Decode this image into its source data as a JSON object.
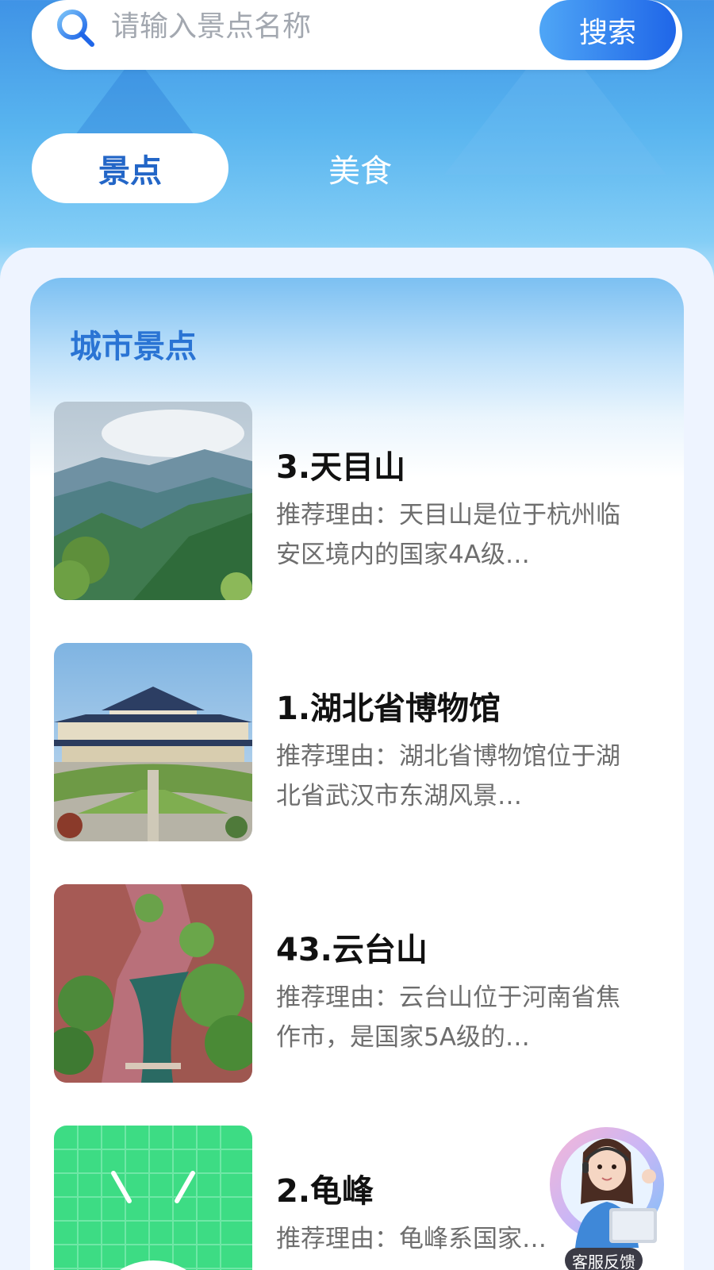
{
  "search": {
    "placeholder": "请输入景点名称",
    "button_label": "搜索"
  },
  "tabs": [
    {
      "label": "景点",
      "active": true
    },
    {
      "label": "美食",
      "active": false
    }
  ],
  "section": {
    "title": "城市景点"
  },
  "items": [
    {
      "title": "3.天目山",
      "desc": "推荐理由：天目山是位于杭州临安区境内的国家4A级…",
      "image": "mountain-landscape"
    },
    {
      "title": "1.湖北省博物馆",
      "desc": "推荐理由：湖北省博物馆位于湖北省武汉市东湖风景…",
      "image": "museum-building"
    },
    {
      "title": "43.云台山",
      "desc": "推荐理由：云台山位于河南省焦作市，是国家5A级的…",
      "image": "canyon-lake"
    },
    {
      "title": "2.龟峰",
      "desc": "推荐理由：龟峰系国家…",
      "image": "android-placeholder"
    }
  ],
  "customer_service": {
    "label": "客服反馈",
    "icon": "agent-avatar-icon"
  },
  "colors": {
    "accent": "#2366c7",
    "button_gradient_start": "#4fa6f6",
    "button_gradient_end": "#1f66e8",
    "title_blue": "#2a74d4"
  }
}
